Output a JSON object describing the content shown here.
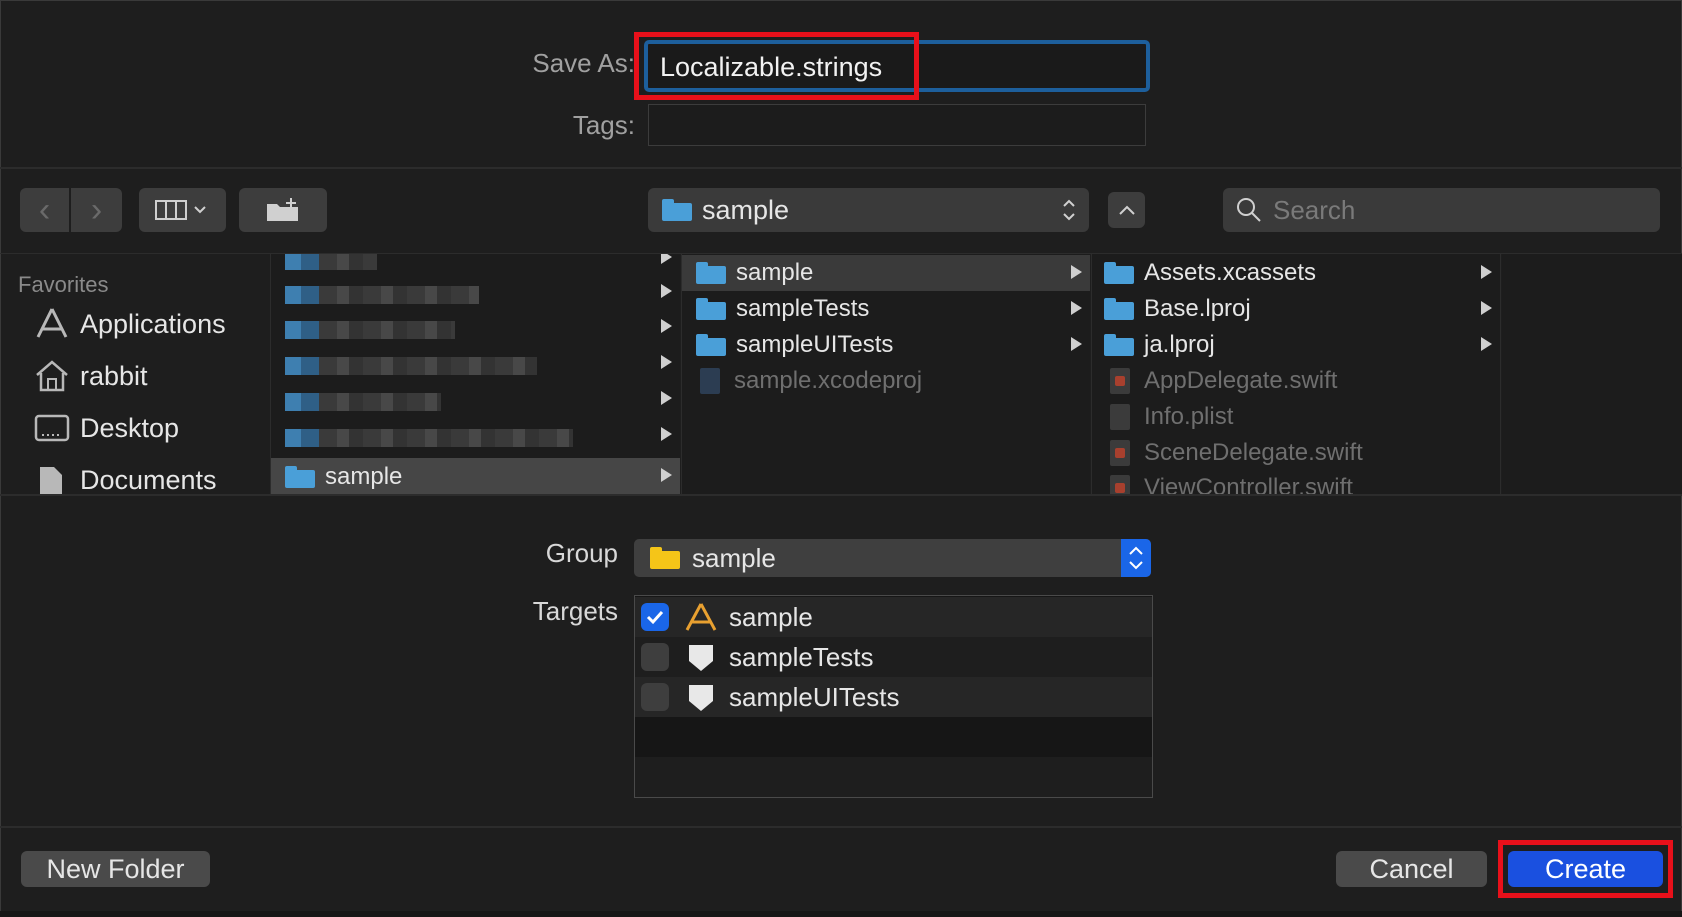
{
  "save_as": {
    "label": "Save As:",
    "value": "Localizable.strings"
  },
  "tags": {
    "label": "Tags:",
    "value": ""
  },
  "toolbar": {
    "location": "sample",
    "search_placeholder": "Search"
  },
  "sidebar": {
    "header": "Favorites",
    "items": [
      {
        "label": "Applications",
        "icon": "applications-icon"
      },
      {
        "label": "rabbit",
        "icon": "home-icon"
      },
      {
        "label": "Desktop",
        "icon": "desktop-icon"
      },
      {
        "label": "Documents",
        "icon": "documents-icon"
      }
    ]
  },
  "columns": {
    "col1": {
      "selected": "sample"
    },
    "col2": [
      {
        "name": "sample",
        "type": "folder"
      },
      {
        "name": "sampleTests",
        "type": "folder"
      },
      {
        "name": "sampleUITests",
        "type": "folder"
      },
      {
        "name": "sample.xcodeproj",
        "type": "file"
      }
    ],
    "col3": [
      {
        "name": "Assets.xcassets",
        "type": "folder"
      },
      {
        "name": "Base.lproj",
        "type": "folder"
      },
      {
        "name": "ja.lproj",
        "type": "folder"
      },
      {
        "name": "AppDelegate.swift",
        "type": "swift"
      },
      {
        "name": "Info.plist",
        "type": "plist"
      },
      {
        "name": "SceneDelegate.swift",
        "type": "swift"
      },
      {
        "name": "ViewController.swift",
        "type": "swift"
      }
    ]
  },
  "group": {
    "label": "Group",
    "value": "sample"
  },
  "targets": {
    "label": "Targets",
    "items": [
      {
        "name": "sample",
        "checked": true
      },
      {
        "name": "sampleTests",
        "checked": false
      },
      {
        "name": "sampleUITests",
        "checked": false
      }
    ]
  },
  "buttons": {
    "new_folder": "New Folder",
    "cancel": "Cancel",
    "create": "Create"
  },
  "colors": {
    "highlight_red": "#e8101a",
    "accent_blue": "#1a66e8",
    "folder_blue": "#4a9fd8",
    "folder_yellow": "#f5c518"
  }
}
